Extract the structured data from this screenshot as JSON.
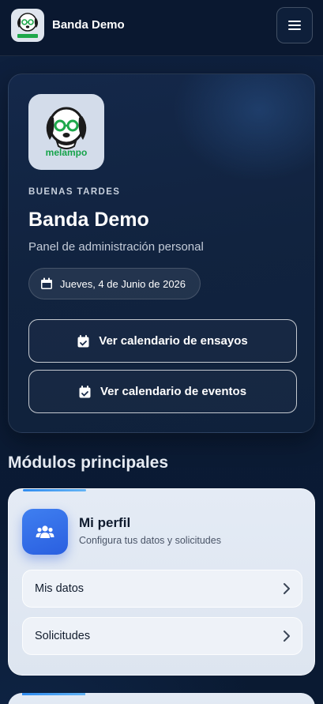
{
  "header": {
    "app_title": "Banda Demo",
    "logo_icon": "dog-logo-icon",
    "menu_icon": "hamburger-icon"
  },
  "hero": {
    "logo_text": "melampo",
    "greeting": "BUENAS TARDES",
    "title": "Banda Demo",
    "subtitle": "Panel de administración personal",
    "date": "Jueves, 4 de Junio de 2026",
    "date_icon": "calendar-icon",
    "buttons": [
      {
        "label": "Ver calendario de ensayos",
        "icon": "calendar-check-icon"
      },
      {
        "label": "Ver calendario de eventos",
        "icon": "calendar-check-icon"
      }
    ]
  },
  "modules": {
    "section_title": "Módulos principales",
    "profile": {
      "title": "Mi perfil",
      "subtitle": "Configura tus datos y solicitudes",
      "icon": "users-icon",
      "items": [
        {
          "label": "Mis datos",
          "icon": "chevron-right-icon"
        },
        {
          "label": "Solicitudes",
          "icon": "chevron-right-icon"
        }
      ]
    }
  },
  "colors": {
    "background": "#0b1a33",
    "card_light": "#e4ebf5",
    "accent_blue": "#2f6ae6",
    "logo_green": "#18a84a"
  }
}
